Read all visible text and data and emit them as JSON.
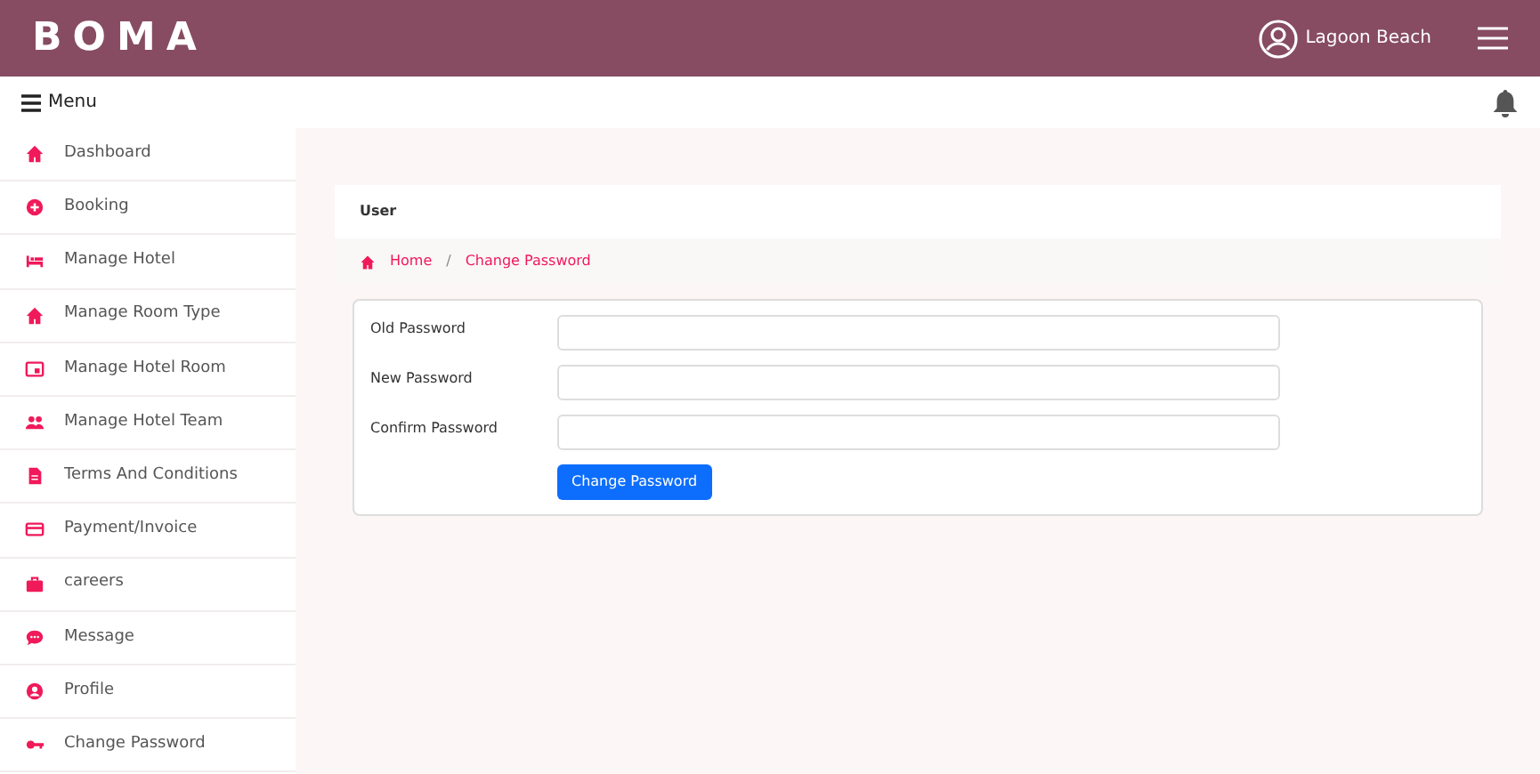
{
  "header": {
    "logo": "BOMA",
    "user": "Lagoon Beach"
  },
  "toolbar": {
    "menu_label": "Menu"
  },
  "sidebar": {
    "items": [
      {
        "label": "Dashboard",
        "kind": "home"
      },
      {
        "label": "Booking",
        "kind": "plus"
      },
      {
        "label": "Manage Hotel",
        "kind": "bed"
      },
      {
        "label": "Manage Room Type",
        "kind": "home"
      },
      {
        "label": "Manage Hotel Room",
        "kind": "room"
      },
      {
        "label": "Manage Hotel Team",
        "kind": "people"
      },
      {
        "label": "Terms And Conditions",
        "kind": "doc"
      },
      {
        "label": "Payment/Invoice",
        "kind": "card"
      },
      {
        "label": "careers",
        "kind": "bag"
      },
      {
        "label": "Message",
        "kind": "chat"
      },
      {
        "label": "Profile",
        "kind": "person"
      },
      {
        "label": "Change Password",
        "kind": "key"
      }
    ]
  },
  "page_title": "User",
  "breadcrumb": {
    "separator": "/",
    "items": [
      "Home",
      "Change Password"
    ]
  },
  "form": {
    "fields": [
      {
        "label": "Old Password"
      },
      {
        "label": "New Password"
      },
      {
        "label": "Confirm Password"
      }
    ],
    "submit": "Change Password"
  }
}
